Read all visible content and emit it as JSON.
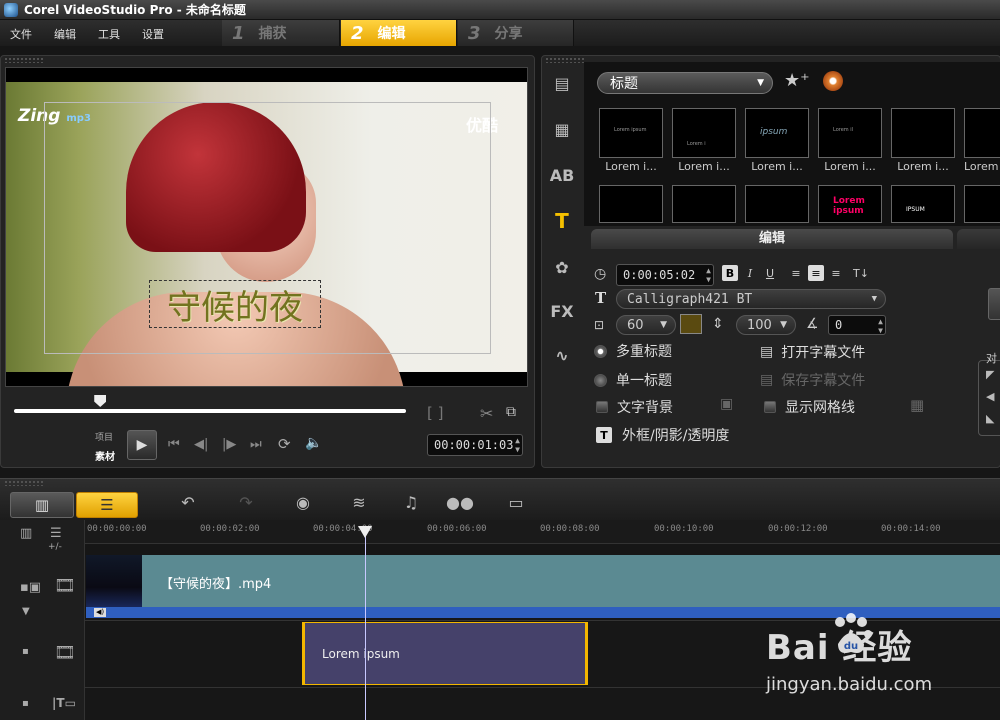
{
  "window": {
    "title": "Corel VideoStudio Pro - 未命名标题"
  },
  "menu": [
    "文件",
    "编辑",
    "工具",
    "设置"
  ],
  "steps": [
    {
      "num": "1",
      "label": "捕获"
    },
    {
      "num": "2",
      "label": "编辑"
    },
    {
      "num": "3",
      "label": "分享"
    }
  ],
  "preview": {
    "title_overlay": "守候的夜",
    "logo_left": "Zing",
    "logo_left_sub": "mp3",
    "logo_right": "优酷",
    "mode_project": "项目",
    "mode_clip": "素材",
    "timecode": "00:00:01:03",
    "scrub_position": 0.22,
    "bracket_icons": "[ ]"
  },
  "library": {
    "category": "标题",
    "thumbnails": [
      {
        "label": "Lorem i...",
        "preview": "Lorem ipsum"
      },
      {
        "label": "Lorem i...",
        "preview": "Lorem i"
      },
      {
        "label": "Lorem i...",
        "preview": "ipsum"
      },
      {
        "label": "Lorem i...",
        "preview": "Lorem il"
      },
      {
        "label": "Lorem i...",
        "preview": ""
      },
      {
        "label": "Lorem",
        "preview": ""
      }
    ],
    "thumbnails_row2": [
      {
        "preview": ""
      },
      {
        "preview": ""
      },
      {
        "preview": ""
      },
      {
        "preview": "Lorem ipsum"
      },
      {
        "preview": "IPSUM"
      },
      {
        "preview": ""
      }
    ]
  },
  "edit": {
    "tab_label": "编辑",
    "duration": "0:00:05:02",
    "font": "Calligraph421 BT",
    "font_size": "60",
    "line_spacing": "100",
    "angle": "0",
    "font_color": "#5a4a10",
    "options": {
      "multi_title": "多重标题",
      "single_title": "单一标题",
      "text_background": "文字背景",
      "show_grid": "显示网格线",
      "border_shadow": "外框/阴影/透明度",
      "open_subtitle": "打开字幕文件",
      "save_subtitle": "保存字幕文件"
    },
    "bold_label": "B",
    "italic_label": "I",
    "underline_label": "U",
    "right_cut_label": "对"
  },
  "timeline": {
    "ruler": [
      "00:00:00:00",
      "00:00:02:00",
      "00:00:04:00",
      "00:00:06:00",
      "00:00:08:00",
      "00:00:10:00",
      "00:00:12:00",
      "00:00:14:00"
    ],
    "video_clip": "【守候的夜】.mp4",
    "title_clip": "Lorem ipsum",
    "zoom_label": "+/-"
  },
  "watermark": {
    "top": "Bai  经验",
    "bottom": "jingyan.baidu.com"
  }
}
